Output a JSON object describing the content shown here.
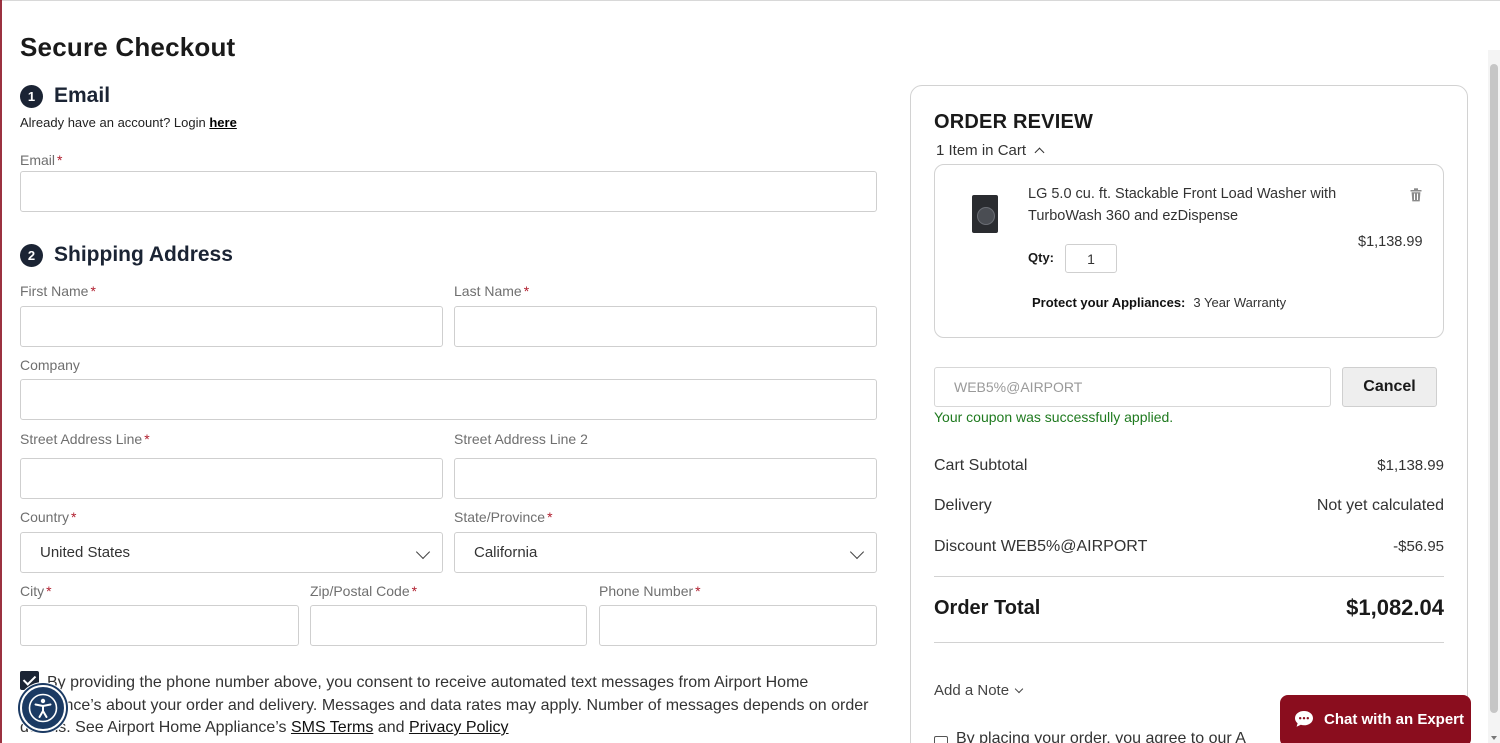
{
  "page": {
    "title": "Secure Checkout"
  },
  "email_section": {
    "step": "1",
    "title": "Email",
    "login_prompt": "Already have an account? Login ",
    "login_link": "here",
    "email_label": "Email",
    "required_mark": "*"
  },
  "shipping_section": {
    "step": "2",
    "title": "Shipping Address",
    "first_name_label": "First Name",
    "last_name_label": "Last Name",
    "company_label": "Company",
    "street1_label": "Street Address Line",
    "street2_label": "Street Address Line 2",
    "country_label": "Country",
    "country_value": "United States",
    "state_label": "State/Province",
    "state_value": "California",
    "city_label": "City",
    "zip_label": "Zip/Postal Code",
    "phone_label": "Phone Number"
  },
  "consent": {
    "checked": true,
    "text_before": "By providing the phone number above, you consent to receive automated text messages from Airport Home Appliance’s about your order and delivery. Messages and data rates may apply. Number of messages depends on order details. See Airport Home Appliance’s ",
    "sms_link": "SMS Terms",
    "and": " and ",
    "privacy_link": "Privacy Policy"
  },
  "order_review": {
    "title": "ORDER REVIEW",
    "items_count": "1 Item in Cart",
    "item": {
      "name": "LG 5.0 cu. ft. Stackable Front Load Washer with TurboWash 360 and ezDispense",
      "price": "$1,138.99",
      "qty_label": "Qty:",
      "qty_value": "1",
      "protect_label": "Protect your Appliances:",
      "protect_value": "3 Year Warranty"
    },
    "coupon": {
      "code": "WEB5%@AIRPORT",
      "cancel_label": "Cancel",
      "message": "Your coupon was successfully applied."
    },
    "summary": {
      "subtotal_label": "Cart Subtotal",
      "subtotal_value": "$1,138.99",
      "delivery_label": "Delivery",
      "delivery_value": "Not yet calculated",
      "discount_label": "Discount WEB5%@AIRPORT",
      "discount_value": "-$56.95",
      "total_label": "Order Total",
      "total_value": "$1,082.04"
    },
    "add_note": "Add a Note",
    "agree_text": "By placing your order, you agree to our A"
  },
  "chat": {
    "label": "Chat with an Expert"
  },
  "colors": {
    "brand": "#8a0d1e",
    "navy": "#1b2434",
    "success": "#1f7a1f",
    "required": "#b01e2e"
  }
}
